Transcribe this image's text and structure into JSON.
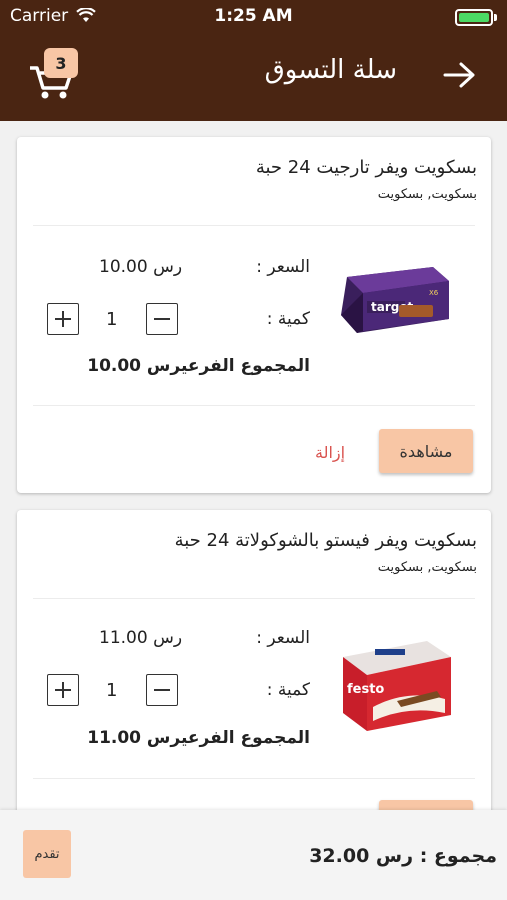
{
  "status_bar": {
    "carrier": "Carrier",
    "time": "1:25 AM"
  },
  "header": {
    "title": "سلة التسوق",
    "cart_count": "3"
  },
  "items": [
    {
      "name": "بسكويت ويفر تارجيت 24 حبة",
      "category": "بسكويت, بسكويت",
      "price_label": "السعر :",
      "price": "رس 10.00",
      "quantity_label": "كمية :",
      "quantity": "1",
      "subtotal": "المجموع الفرعيرس 10.00",
      "view_label": "مشاهدة",
      "remove_label": "إزالة"
    },
    {
      "name": "بسكويت ويفر فيستو بالشوكولاتة 24 حبة",
      "category": "بسكويت, بسكويت",
      "price_label": "السعر :",
      "price": "رس 11.00",
      "quantity_label": "كمية :",
      "quantity": "1",
      "subtotal": "المجموع الفرعيرس 11.00"
    }
  ],
  "footer": {
    "proceed_label": "تقدم",
    "total": "مجموع : رس 32.00"
  },
  "colors": {
    "header_bg": "#4a2512",
    "accent": "#f8c6a5",
    "remove": "#d9534f"
  },
  "icons": [
    "wifi-icon",
    "battery-icon",
    "back-arrow-icon",
    "cart-icon",
    "plus-icon",
    "minus-icon"
  ]
}
